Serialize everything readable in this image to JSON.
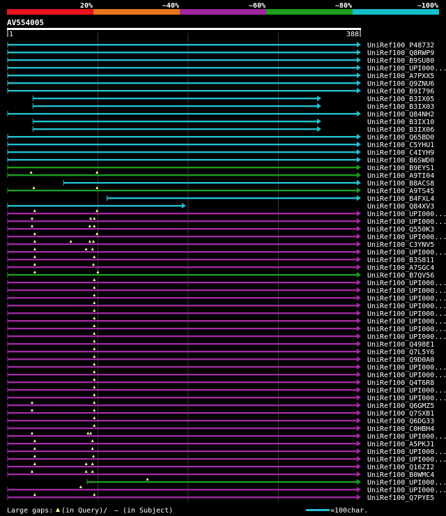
{
  "colors": {
    "background": "#000000",
    "identity_bins": [
      "#e8141e",
      "#e8761e",
      "#a0279e",
      "#1e9e1e",
      "#14bfc8"
    ],
    "cyan": "#20c0d0",
    "green": "#1c9c1c",
    "purple": "#a02aa0",
    "gap_marker": "#ffffa0",
    "grid": "#3a3a3a"
  },
  "legend_top": {
    "labels": [
      "20%",
      "~40%",
      "~60%",
      "~80%",
      "~100%"
    ]
  },
  "query": {
    "name": "AV554005",
    "start": "1",
    "end": "388",
    "length": 388
  },
  "chart_data": {
    "type": "alignment-overview",
    "query_length": 388,
    "hits": [
      {
        "name": "UniRef100_P48732",
        "color": "cyan",
        "start": 1,
        "end": 388,
        "gaps": []
      },
      {
        "name": "UniRef100_Q8RWP9",
        "color": "cyan",
        "start": 1,
        "end": 388,
        "gaps": []
      },
      {
        "name": "UniRef100_B9SU80",
        "color": "cyan",
        "start": 1,
        "end": 388,
        "gaps": []
      },
      {
        "name": "UniRef100_UPI000...",
        "color": "cyan",
        "start": 1,
        "end": 388,
        "gaps": []
      },
      {
        "name": "UniRef100_A7PXX5",
        "color": "cyan",
        "start": 1,
        "end": 388,
        "gaps": []
      },
      {
        "name": "UniRef100_Q9ZNU6",
        "color": "cyan",
        "start": 1,
        "end": 388,
        "gaps": []
      },
      {
        "name": "UniRef100_B9I796",
        "color": "cyan",
        "start": 1,
        "end": 388,
        "gaps": []
      },
      {
        "name": "UniRef100_B3IX05",
        "color": "cyan",
        "start": 29,
        "end": 344,
        "gaps": []
      },
      {
        "name": "UniRef100_B3IX03",
        "color": "cyan",
        "start": 29,
        "end": 344,
        "gaps": []
      },
      {
        "name": "UniRef100_Q84NH2",
        "color": "cyan",
        "start": 1,
        "end": 388,
        "gaps": []
      },
      {
        "name": "UniRef100_B3IX10",
        "color": "cyan",
        "start": 29,
        "end": 344,
        "gaps": []
      },
      {
        "name": "UniRef100_B3IX06",
        "color": "cyan",
        "start": 29,
        "end": 344,
        "gaps": []
      },
      {
        "name": "UniRef100_Q65BD0",
        "color": "cyan",
        "start": 1,
        "end": 388,
        "gaps": []
      },
      {
        "name": "UniRef100_C5YHU1",
        "color": "cyan",
        "start": 1,
        "end": 388,
        "gaps": []
      },
      {
        "name": "UniRef100_C4IYH9",
        "color": "cyan",
        "start": 1,
        "end": 388,
        "gaps": []
      },
      {
        "name": "UniRef100_B6SWD0",
        "color": "cyan",
        "start": 1,
        "end": 388,
        "gaps": []
      },
      {
        "name": "UniRef100_B9EYS1",
        "color": "green",
        "start": 1,
        "end": 388,
        "gaps": []
      },
      {
        "name": "UniRef100_A9TI04",
        "color": "green",
        "start": 1,
        "end": 388,
        "gaps": [
          27,
          100
        ]
      },
      {
        "name": "UniRef100_B8ACS8",
        "color": "cyan",
        "start": 63,
        "end": 388,
        "gaps": []
      },
      {
        "name": "UniRef100_A9TS45",
        "color": "green",
        "start": 1,
        "end": 388,
        "gaps": [
          30,
          100
        ]
      },
      {
        "name": "UniRef100_B4FXL4",
        "color": "cyan",
        "start": 111,
        "end": 388,
        "gaps": []
      },
      {
        "name": "UniRef100_Q84XV3",
        "color": "cyan",
        "start": 1,
        "end": 194,
        "gaps": []
      },
      {
        "name": "UniRef100_UPI000...",
        "color": "purple",
        "start": 1,
        "end": 388,
        "gaps": [
          31,
          100
        ]
      },
      {
        "name": "UniRef100_UPI000...",
        "color": "purple",
        "start": 1,
        "end": 388,
        "gaps": [
          28,
          93,
          97
        ]
      },
      {
        "name": "UniRef100_Q550K3",
        "color": "purple",
        "start": 1,
        "end": 388,
        "gaps": [
          28,
          92,
          97
        ]
      },
      {
        "name": "UniRef100_UPI000...",
        "color": "purple",
        "start": 1,
        "end": 388,
        "gaps": [
          31,
          100
        ]
      },
      {
        "name": "UniRef100_C3YNV5",
        "color": "purple",
        "start": 1,
        "end": 388,
        "gaps": [
          31,
          71,
          92,
          96
        ]
      },
      {
        "name": "UniRef100_UPI000...",
        "color": "purple",
        "start": 1,
        "end": 388,
        "gaps": [
          31,
          88,
          95
        ]
      },
      {
        "name": "UniRef100_B3S811",
        "color": "purple",
        "start": 1,
        "end": 388,
        "gaps": [
          31,
          97
        ]
      },
      {
        "name": "UniRef100_A7SGC4",
        "color": "purple",
        "start": 1,
        "end": 388,
        "gaps": [
          31,
          96
        ]
      },
      {
        "name": "UniRef100_B7QV56",
        "color": "green",
        "start": 1,
        "end": 388,
        "gaps": [
          31,
          101
        ]
      },
      {
        "name": "UniRef100_UPI000...",
        "color": "purple",
        "start": 1,
        "end": 388,
        "gaps": [
          97
        ]
      },
      {
        "name": "UniRef100_UPI000...",
        "color": "purple",
        "start": 1,
        "end": 388,
        "gaps": [
          97
        ]
      },
      {
        "name": "UniRef100_UPI000...",
        "color": "purple",
        "start": 1,
        "end": 388,
        "gaps": [
          97
        ]
      },
      {
        "name": "UniRef100_UPI000...",
        "color": "purple",
        "start": 1,
        "end": 388,
        "gaps": [
          97
        ]
      },
      {
        "name": "UniRef100_UPI000...",
        "color": "purple",
        "start": 1,
        "end": 388,
        "gaps": [
          97
        ]
      },
      {
        "name": "UniRef100_UPI000...",
        "color": "purple",
        "start": 1,
        "end": 388,
        "gaps": [
          97
        ]
      },
      {
        "name": "UniRef100_UPI000...",
        "color": "purple",
        "start": 1,
        "end": 388,
        "gaps": [
          97
        ]
      },
      {
        "name": "UniRef100_UPI000...",
        "color": "purple",
        "start": 1,
        "end": 388,
        "gaps": [
          97
        ]
      },
      {
        "name": "UniRef100_Q498E1",
        "color": "purple",
        "start": 1,
        "end": 388,
        "gaps": [
          97
        ]
      },
      {
        "name": "UniRef100_Q7L5Y6",
        "color": "purple",
        "start": 1,
        "end": 388,
        "gaps": [
          97
        ]
      },
      {
        "name": "UniRef100_Q9D0A0",
        "color": "purple",
        "start": 1,
        "end": 388,
        "gaps": [
          97
        ]
      },
      {
        "name": "UniRef100_UPI000...",
        "color": "purple",
        "start": 1,
        "end": 388,
        "gaps": [
          97
        ]
      },
      {
        "name": "UniRef100_UPI000...",
        "color": "purple",
        "start": 1,
        "end": 388,
        "gaps": [
          97
        ]
      },
      {
        "name": "UniRef100_Q4T6R8",
        "color": "purple",
        "start": 1,
        "end": 388,
        "gaps": [
          97
        ]
      },
      {
        "name": "UniRef100_UPI000...",
        "color": "purple",
        "start": 1,
        "end": 388,
        "gaps": [
          97
        ]
      },
      {
        "name": "UniRef100_UPI000...",
        "color": "purple",
        "start": 1,
        "end": 388,
        "gaps": [
          97
        ]
      },
      {
        "name": "UniRef100_Q6GMZ5",
        "color": "purple",
        "start": 1,
        "end": 388,
        "gaps": [
          28,
          97
        ]
      },
      {
        "name": "UniRef100_Q7SXB1",
        "color": "purple",
        "start": 1,
        "end": 388,
        "gaps": [
          28,
          97
        ]
      },
      {
        "name": "UniRef100_Q6DG33",
        "color": "purple",
        "start": 1,
        "end": 388,
        "gaps": [
          97
        ]
      },
      {
        "name": "UniRef100_C0HBH4",
        "color": "purple",
        "start": 1,
        "end": 388,
        "gaps": [
          97
        ]
      },
      {
        "name": "UniRef100_UPI000...",
        "color": "purple",
        "start": 1,
        "end": 388,
        "gaps": [
          28,
          90,
          93
        ]
      },
      {
        "name": "UniRef100_A5PKJ1",
        "color": "purple",
        "start": 1,
        "end": 388,
        "gaps": [
          31,
          95
        ]
      },
      {
        "name": "UniRef100_UPI000...",
        "color": "purple",
        "start": 1,
        "end": 388,
        "gaps": [
          31,
          95
        ]
      },
      {
        "name": "UniRef100_UPI000...",
        "color": "purple",
        "start": 1,
        "end": 388,
        "gaps": [
          31,
          96
        ]
      },
      {
        "name": "UniRef100_Q16ZI2",
        "color": "purple",
        "start": 1,
        "end": 388,
        "gaps": [
          31,
          88,
          95
        ]
      },
      {
        "name": "UniRef100_B0WMC4",
        "color": "purple",
        "start": 1,
        "end": 388,
        "gaps": [
          28,
          88,
          95
        ]
      },
      {
        "name": "UniRef100_UPI000...",
        "color": "green",
        "start": 89,
        "end": 388,
        "gaps": [
          156
        ]
      },
      {
        "name": "UniRef100_UPI000...",
        "color": "purple",
        "start": 1,
        "end": 388,
        "gaps": [
          82
        ]
      },
      {
        "name": "UniRef100_Q7PYE5",
        "color": "purple",
        "start": 1,
        "end": 388,
        "gaps": [
          31,
          97
        ]
      }
    ]
  },
  "legend_bottom": {
    "large_gaps_label": "Large gaps:",
    "in_query": "(in Query)/",
    "dash": "—",
    "in_subject": "(in Subject)",
    "scale_label": "=100char."
  }
}
